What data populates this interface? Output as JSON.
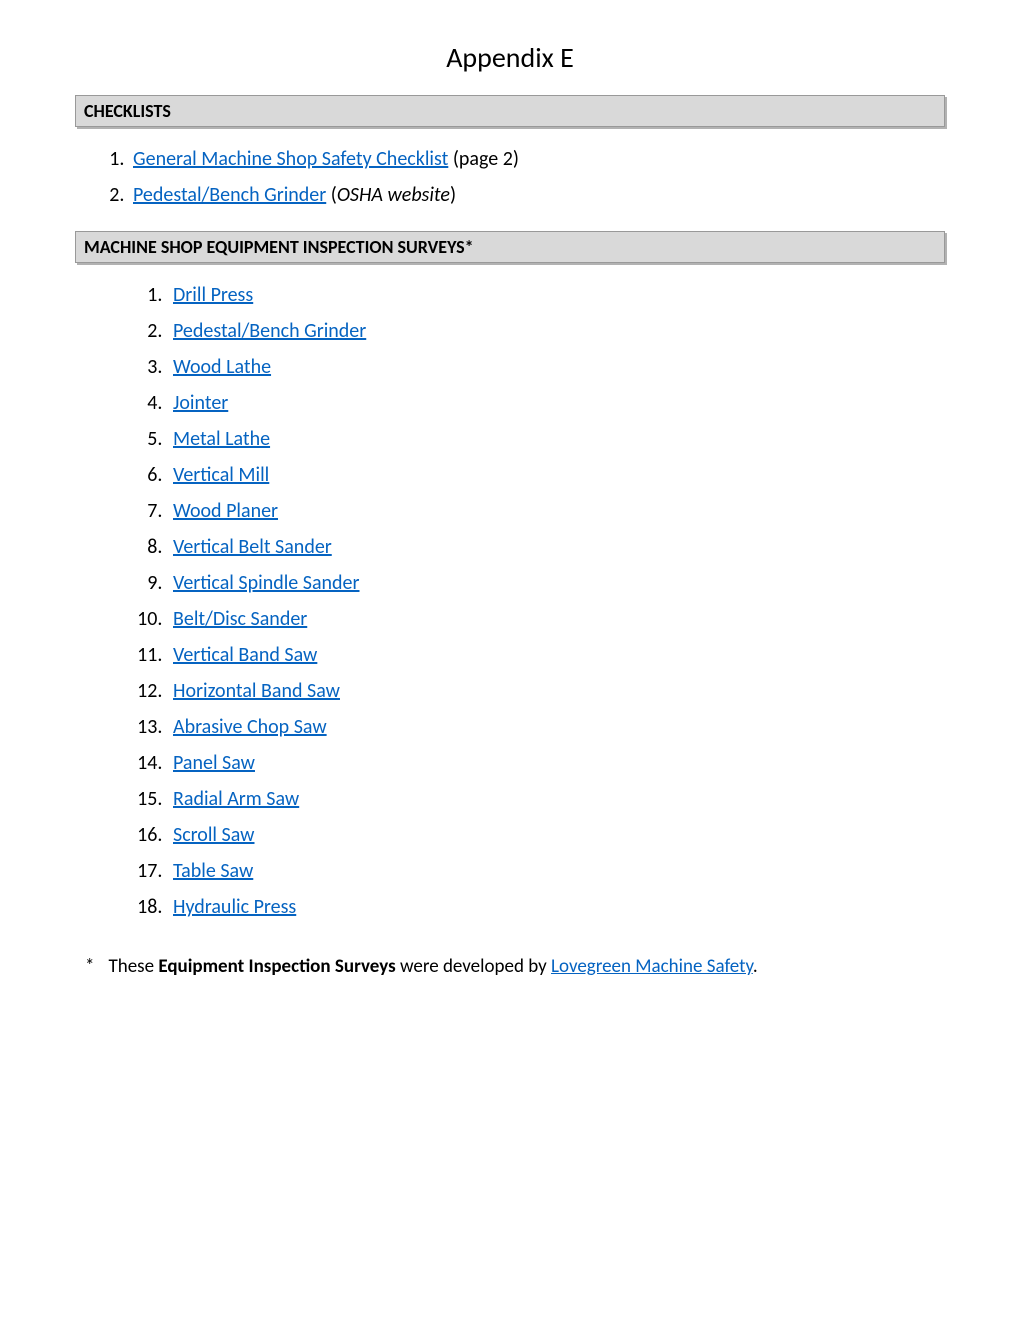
{
  "title": "Appendix E",
  "sections": {
    "checklists": {
      "header": "CHECKLISTS",
      "items": [
        {
          "link": "General Machine Shop Safety Checklist",
          "suffix": " (page 2)",
          "suffix_italic": false
        },
        {
          "link": "Pedestal/Bench Grinder",
          "suffix_open": " (",
          "suffix_italic_text": "OSHA website",
          "suffix_close": ")"
        }
      ]
    },
    "surveys": {
      "header": "MACHINE SHOP EQUIPMENT INSPECTION SURVEYS*",
      "items": [
        "Drill Press",
        "Pedestal/Bench Grinder ",
        "Wood Lathe",
        "Jointer",
        "Metal Lathe",
        "Vertical Mill",
        "Wood Planer ",
        "Vertical Belt Sander",
        "Vertical Spindle Sander",
        "Belt/Disc Sander",
        "Vertical Band Saw",
        "Horizontal Band Saw",
        "Abrasive Chop Saw",
        "Panel Saw",
        "Radial Arm Saw",
        "Scroll Saw",
        "Table Saw",
        "Hydraulic Press"
      ]
    }
  },
  "footnote": {
    "marker": "*",
    "pre": "These ",
    "bold": "Equipment Inspection Surveys",
    "mid": " were developed by ",
    "link": "Lovegreen Machine Safety",
    "post": "."
  }
}
